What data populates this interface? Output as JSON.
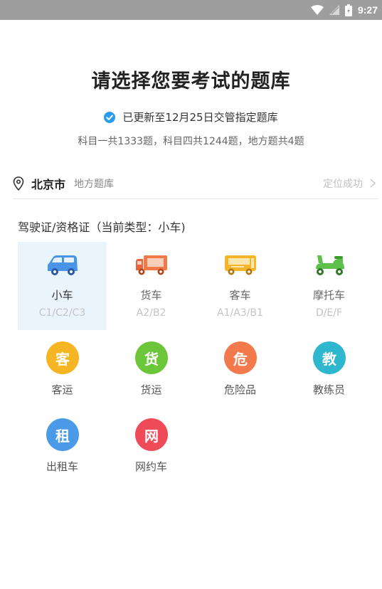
{
  "status_bar": {
    "time": "9:27",
    "icons": [
      "wifi-icon",
      "signal-icon",
      "battery-icon"
    ]
  },
  "title": "请选择您要考试的题库",
  "update_notice": "已更新至12月25日交管指定题库",
  "counts_text": "科目一共1333题，科目四共1244题，地方题共4题",
  "location": {
    "city": "北京市",
    "bank": "地方题库",
    "status": "定位成功"
  },
  "section_label": "驾驶证/资格证（当前类型：小车)",
  "vehicles": [
    {
      "name": "小车",
      "code": "C1/C2/C3",
      "selected": true,
      "color": "#3a8ee6"
    },
    {
      "name": "货车",
      "code": "A2/B2",
      "selected": false,
      "color": "#f07a4a"
    },
    {
      "name": "客车",
      "code": "A1/A3/B1",
      "selected": false,
      "color": "#f5b52a"
    },
    {
      "name": "摩托车",
      "code": "D/E/F",
      "selected": false,
      "color": "#5cc04a"
    }
  ],
  "qualifications": [
    {
      "char": "客",
      "label": "客运",
      "color": "#f6b624"
    },
    {
      "char": "货",
      "label": "货运",
      "color": "#6cc63a"
    },
    {
      "char": "危",
      "label": "危险品",
      "color": "#f27a4c"
    },
    {
      "char": "教",
      "label": "教练员",
      "color": "#2fb7cf"
    },
    {
      "char": "租",
      "label": "出租车",
      "color": "#4a9ae8"
    },
    {
      "char": "网",
      "label": "网约车",
      "color": "#ee4a58"
    }
  ]
}
